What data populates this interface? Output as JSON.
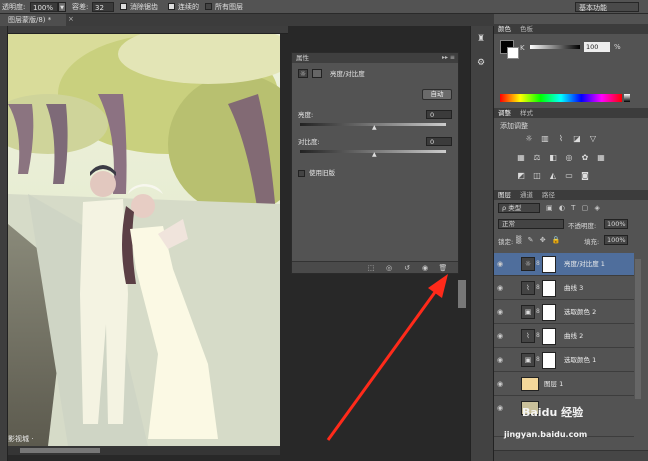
{
  "options_bar": {
    "opacity_label": "透明度:",
    "opacity_value": "100%",
    "tolerance_label": "容差:",
    "tolerance_value": "32",
    "antialias_label": "消除锯齿",
    "contiguous_label": "连续的",
    "all_layers_label": "所有图层",
    "workspace": "基本功能"
  },
  "document": {
    "tab_title": "图层蒙版/8) *"
  },
  "properties_panel": {
    "title": "属性",
    "adjustment_name": "亮度/对比度",
    "auto_button": "自动",
    "brightness_label": "亮度:",
    "brightness_value": "0",
    "contrast_label": "对比度:",
    "contrast_value": "0",
    "legacy_label": "使用旧版"
  },
  "color_panel": {
    "tab_color": "颜色",
    "tab_swatches": "色板",
    "channel_label": "K",
    "channel_value": "100",
    "unit": "%"
  },
  "adjustments_panel": {
    "tab_adjust": "调整",
    "tab_styles": "样式",
    "add_label": "添加调整"
  },
  "layers_panel": {
    "tab_layers": "图层",
    "tab_channels": "通道",
    "tab_paths": "路径",
    "filter_kind": "类型",
    "blend_mode": "正常",
    "opacity_label": "不透明度:",
    "opacity_value": "100%",
    "lock_label": "锁定:",
    "fill_label": "填充:",
    "fill_value": "100%",
    "layers": [
      {
        "name": "亮度/对比度 1",
        "icon": "brightness-icon"
      },
      {
        "name": "曲线 3",
        "icon": "curves-icon"
      },
      {
        "name": "选取颜色 2",
        "icon": "selective-color-icon"
      },
      {
        "name": "曲线 2",
        "icon": "curves-icon"
      },
      {
        "name": "选取颜色 1",
        "icon": "selective-color-icon"
      },
      {
        "name": "图层 1",
        "icon": "layer-thumb"
      }
    ]
  },
  "watermark": {
    "text": "jingyan.baidu.com",
    "logo_text": "Baidu 经验"
  },
  "colors": {
    "selected_layer": "#4f6e9c",
    "arrow": "#ff2a1a"
  }
}
